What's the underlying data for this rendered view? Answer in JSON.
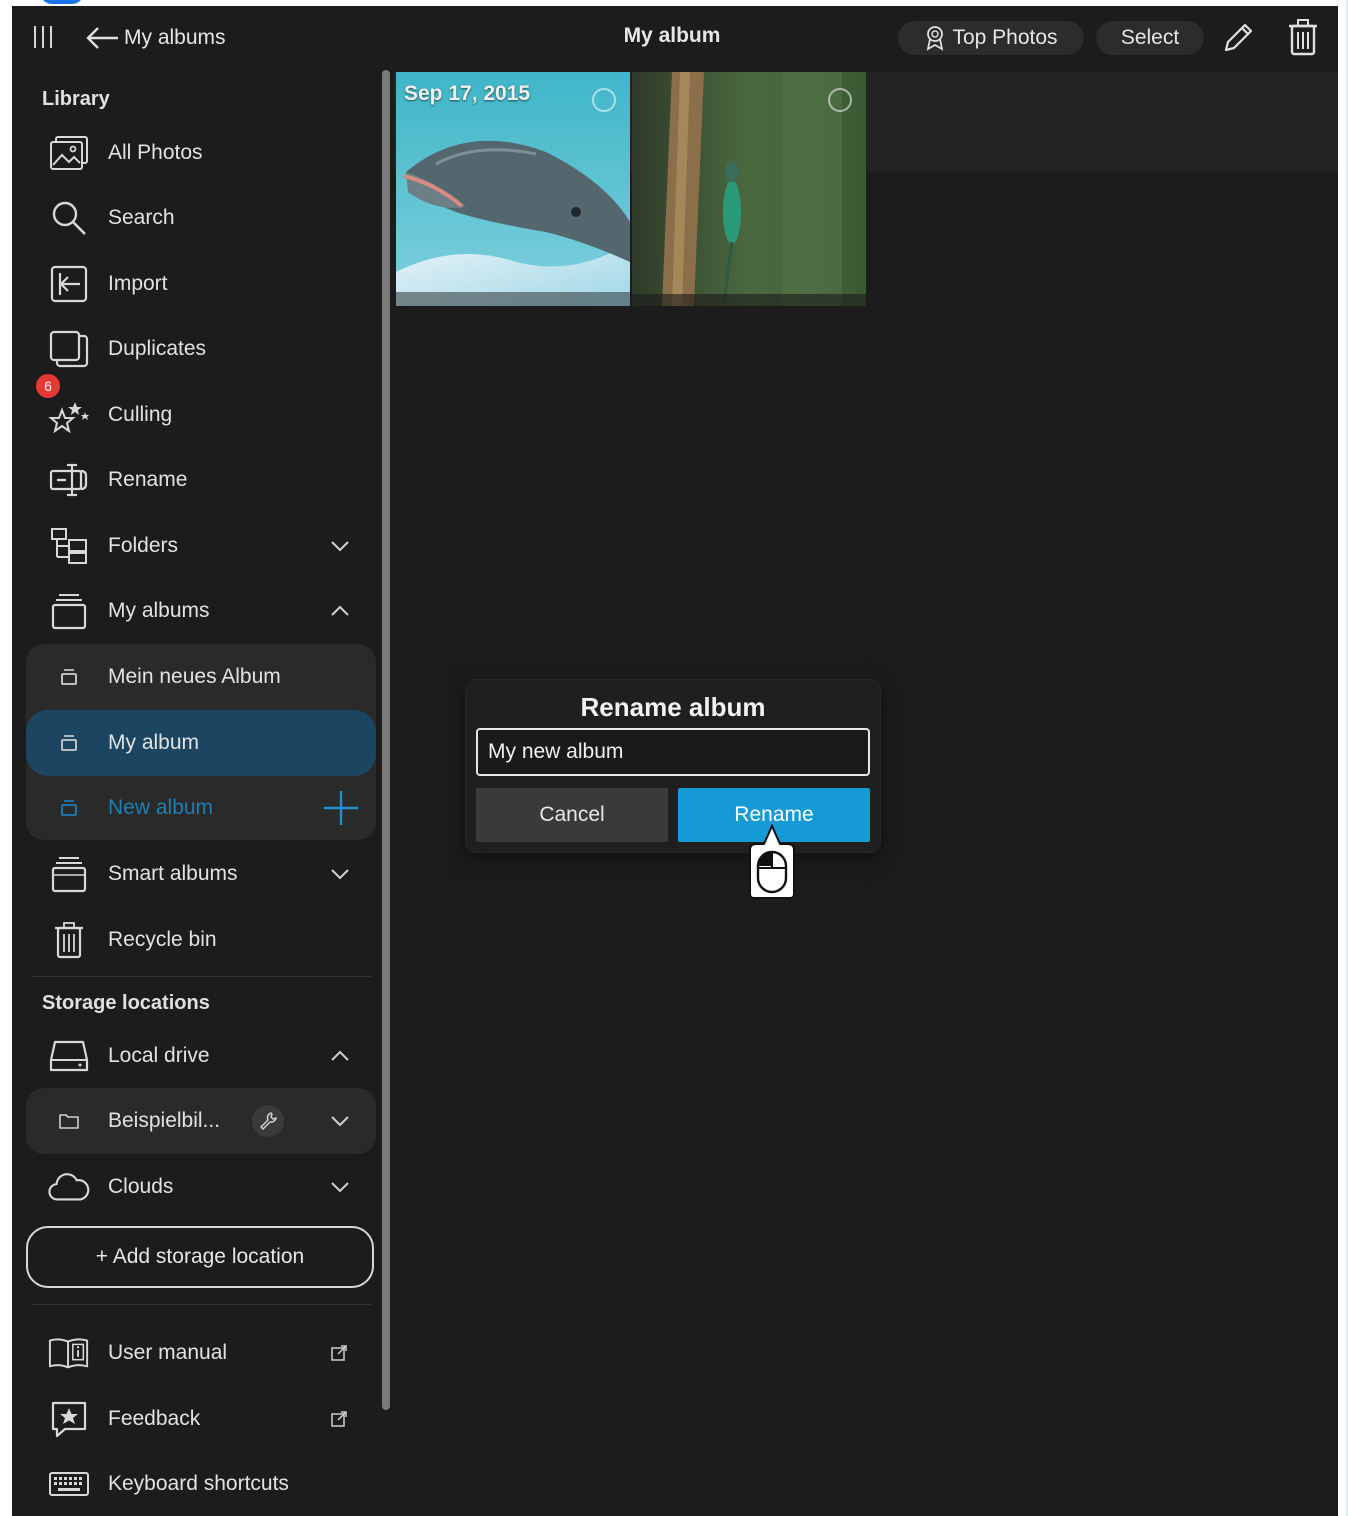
{
  "topbar": {
    "back_label": "My albums",
    "title": "My album",
    "top_photos_label": "Top Photos",
    "select_label": "Select"
  },
  "sidebar": {
    "library_title": "Library",
    "items": {
      "all_photos": "All Photos",
      "search": "Search",
      "import": "Import",
      "duplicates": "Duplicates",
      "culling": "Culling",
      "culling_badge": "6",
      "rename": "Rename",
      "folders": "Folders",
      "my_albums": "My albums",
      "smart_albums": "Smart albums",
      "recycle_bin": "Recycle bin"
    },
    "albums": [
      "Mein neues Album",
      "My album"
    ],
    "new_album_label": "New album",
    "storage_title": "Storage locations",
    "local_drive": "Local drive",
    "folder_name": "Beispielbil...",
    "clouds": "Clouds",
    "add_storage_label": "+ Add storage location",
    "user_manual": "User manual",
    "feedback": "Feedback",
    "keyboard_shortcuts": "Keyboard shortcuts"
  },
  "photos": [
    {
      "date": "Sep 17, 2015",
      "subject": "dolphin"
    },
    {
      "date": "",
      "subject": "dragonfly"
    }
  ],
  "dialog": {
    "title": "Rename album",
    "input_value": "My new album",
    "cancel_label": "Cancel",
    "rename_label": "Rename"
  },
  "colors": {
    "background": "#1c1c1c",
    "accent": "#159ad6",
    "active_album_bg": "#1b4560",
    "new_album_text": "#1e7fb5",
    "badge": "#e53935"
  }
}
